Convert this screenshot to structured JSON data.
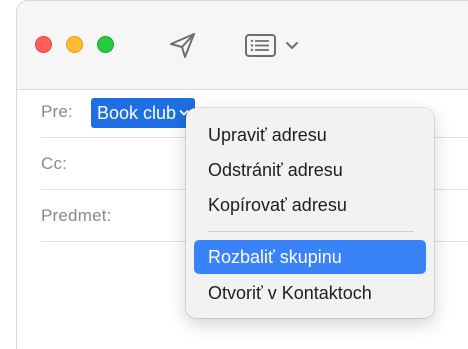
{
  "toolbar": {
    "send_icon": "paper-plane-icon",
    "header_fields_icon": "header-fields-icon",
    "header_fields_chevron": "chevron-down-icon"
  },
  "fields": {
    "to_label": "Pre:",
    "cc_label": "Cc:",
    "subject_label": "Predmet:"
  },
  "recipient_token": {
    "label": "Book club",
    "color": "#1d6fe3"
  },
  "context_menu": {
    "items": [
      {
        "label": "Upraviť adresu"
      },
      {
        "label": "Odstrániť adresu"
      },
      {
        "label": "Kopírovať adresu"
      },
      {
        "label": "Rozbaliť skupinu",
        "selected": true
      },
      {
        "label": "Otvoriť v Kontaktoch"
      }
    ],
    "highlight_color": "#3a82f7"
  }
}
